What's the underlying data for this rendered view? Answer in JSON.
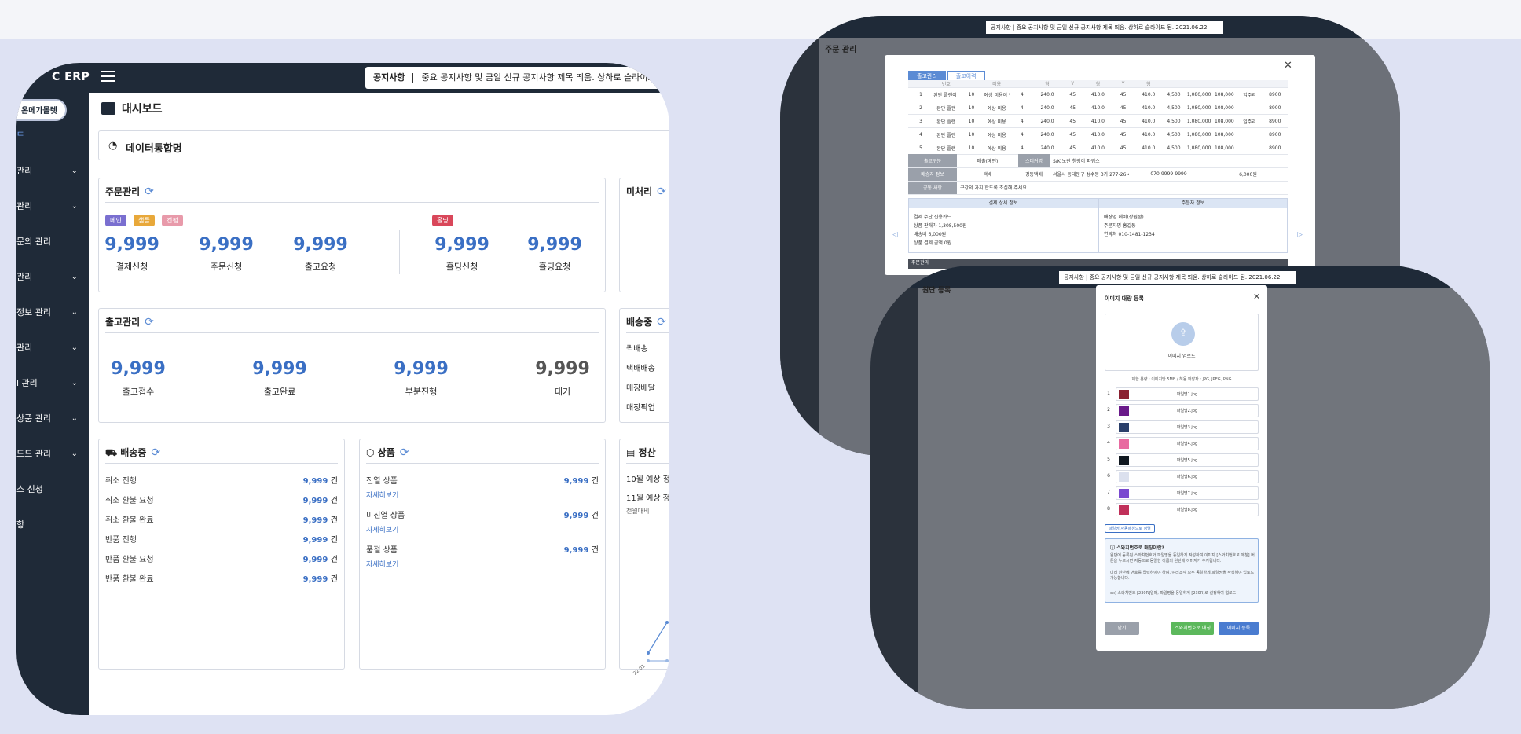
{
  "dashboard": {
    "logo": "C ERP",
    "notice_label": "공지사항",
    "notice_text": "중요 공지사항 및 금일 신규 공지사항 제목 띄움. 상하로 슬라이드",
    "sidebar_button": "온메가몰렛",
    "sidebar": [
      {
        "label": "드",
        "chev": ""
      },
      {
        "label": "관리",
        "chev": "⌄"
      },
      {
        "label": "관리",
        "chev": "⌄"
      },
      {
        "label": "문의 관리",
        "chev": ""
      },
      {
        "label": "관리",
        "chev": "⌄"
      },
      {
        "label": "정보 관리",
        "chev": "⌄"
      },
      {
        "label": "관리",
        "chev": "⌄"
      },
      {
        "label": "l 관리",
        "chev": "⌄"
      },
      {
        "label": "상품 관리",
        "chev": "⌄"
      },
      {
        "label": "드드 관리",
        "chev": "⌄"
      },
      {
        "label": "스 신청",
        "chev": ""
      },
      {
        "label": "항",
        "chev": ""
      }
    ],
    "page_title": "대시보드",
    "data_title": "데이터통합명",
    "order": {
      "title": "주문관리",
      "badges": [
        "메인",
        "샘플",
        "컨펌",
        "홀딩"
      ],
      "stats": [
        {
          "value": "9,999",
          "label": "결제신청"
        },
        {
          "value": "9,999",
          "label": "주문신청"
        },
        {
          "value": "9,999",
          "label": "출고요청"
        },
        {
          "value": "9,999",
          "label": "홀딩신청"
        },
        {
          "value": "9,999",
          "label": "홀딩요청"
        }
      ]
    },
    "pending": {
      "title": "미처리"
    },
    "release": {
      "title": "출고관리",
      "stats": [
        {
          "value": "9,999",
          "label": "출고접수"
        },
        {
          "value": "9,999",
          "label": "출고완료"
        },
        {
          "value": "9,999",
          "label": "부분진행"
        },
        {
          "value": "9,999",
          "label": "대기"
        }
      ]
    },
    "shipping_side": {
      "title": "배송중",
      "items": [
        "퀵배송",
        "택배배송",
        "매장배달",
        "매장픽업"
      ]
    },
    "shipping": {
      "title": "배송중",
      "unit": "건",
      "rows": [
        {
          "label": "취소 진행",
          "value": "9,999"
        },
        {
          "label": "취소 환불 요청",
          "value": "9,999"
        },
        {
          "label": "취소 환불 완료",
          "value": "9,999"
        },
        {
          "label": "반품 진행",
          "value": "9,999"
        },
        {
          "label": "반품 환불 요청",
          "value": "9,999"
        },
        {
          "label": "반품 환불 완료",
          "value": "9,999"
        }
      ]
    },
    "product": {
      "title": "상품",
      "unit": "건",
      "more": "자세히보기",
      "rows": [
        {
          "label": "진열 상품",
          "value": "9,999"
        },
        {
          "label": "미진열 상품",
          "value": "9,999"
        },
        {
          "label": "품절 상품",
          "value": "9,999"
        }
      ]
    },
    "settle": {
      "title": "정산",
      "rows": [
        "10월 예상 정",
        "11월 예상 정",
        "전월대비"
      ],
      "axis_label": "22.01"
    }
  },
  "order_modal": {
    "ticker": "공지사항  |  중요 공지사항 및 금일 신규 공지사항 제목 띄움. 상하로 슬라이드 됨.        2021.06.22",
    "page_title": "주문 관리",
    "tabs": [
      "출고관리",
      "출고이력"
    ],
    "header": [
      "",
      "번호",
      "",
      "미용",
      "",
      "형",
      "Y",
      "형",
      "Y",
      "형",
      "",
      "",
      "",
      "",
      "",
      "",
      "",
      "",
      "",
      ""
    ],
    "rows": [
      [
        "1",
        "완단 플랜이 잘려지면 ...",
        "10",
        "예상 미용이 잘린...",
        "4",
        "240.0",
        "45",
        "410.0",
        "45",
        "410.0",
        "4,500",
        "1,080,000",
        "108,000",
        "입주리",
        "8900"
      ],
      [
        "2",
        "완단 플랜",
        "10",
        "예상 미용",
        "4",
        "240.0",
        "45",
        "410.0",
        "45",
        "410.0",
        "4,500",
        "1,080,000",
        "108,000",
        "",
        "8900"
      ],
      [
        "3",
        "완단 플랜",
        "10",
        "예상 미용",
        "4",
        "240.0",
        "45",
        "410.0",
        "45",
        "410.0",
        "4,500",
        "1,080,000",
        "108,000",
        "입주리",
        "8900"
      ],
      [
        "4",
        "완단 플랜",
        "10",
        "예상 미용",
        "4",
        "240.0",
        "45",
        "410.0",
        "45",
        "410.0",
        "4,500",
        "1,080,000",
        "108,000",
        "",
        "8900"
      ],
      [
        "5",
        "완단 플랜",
        "10",
        "예상 미용",
        "4",
        "240.0",
        "45",
        "410.0",
        "45",
        "410.0",
        "4,500",
        "1,080,000",
        "108,000",
        "",
        "8900"
      ]
    ],
    "release_type_label": "출고구분",
    "release_type": "매출(메인)",
    "sticker_label": "스티커명",
    "sticker": "S/K 노란 행랭이 파워스",
    "delivery_label": "배송지 정보",
    "delivery_method": "택배",
    "receiver": "경동택배",
    "address": "서울시 동대문구 성수동 3가 277-26 4층",
    "phone": "070-9999-9999",
    "fee": "6,000원",
    "memo_label": "공동 사항",
    "memo": "구강의 가지 합도록 조심해 주세요.",
    "payment_caption": "결제 상세 정보",
    "orderer_caption": "주문자 정보",
    "payment": [
      "결제 수단   신용카드",
      "상품 판매가   1,308,500원",
      "배송비   6,000원",
      "상품 결제 금액   0원"
    ],
    "orderer": [
      "매장명   메비(장원점)",
      "주문자명   홍길동",
      "연락처   010-1481-1234"
    ],
    "footer": "주문관리"
  },
  "upload_modal": {
    "ticker": "공지사항  |  중요 공지사항 및 금일 신규 공지사항 제목 띄움. 상하로 슬라이드 됨.      2021.06.22",
    "page_title": "원단 등록",
    "title": "이미지 대량 등록",
    "upload": "이미지 업로드",
    "hint": "제한 용량 : 이미지당 5MB / 허용 확장자 : JPG, JPEG, PNG",
    "files": [
      {
        "n": "1",
        "name": "파일명1.jpg",
        "color": "#8a2030"
      },
      {
        "n": "2",
        "name": "파일명2.jpg",
        "color": "#6a1a8a"
      },
      {
        "n": "3",
        "name": "파일명3.jpg",
        "color": "#2a3f6a"
      },
      {
        "n": "4",
        "name": "파일명4.jpg",
        "color": "#e86aa0"
      },
      {
        "n": "5",
        "name": "파일명5.jpg",
        "color": "#101820"
      },
      {
        "n": "6",
        "name": "파일명6.jpg",
        "color": "#dbe0ee"
      },
      {
        "n": "7",
        "name": "파일명7.jpg",
        "color": "#7a4ad0"
      },
      {
        "n": "8",
        "name": "파일명8.jpg",
        "color": "#c0305a"
      }
    ],
    "auto_match": "파일명 자동매칭으로 정렬",
    "info_title": "스와치번호로 매칭이란?",
    "info_1": "원단에 등록된 스와치번호와 파일명을 동일하게 작성하여 이미지 [스와치번호로 매칭] 버튼을 누르시면 자동으로 동일한 이름의 원단에 이미지가 추가됩니다.",
    "info_2": "미리 원단에 번호를 입력하여야 하며, 여러조각 모두 동일하게 파일명을 작성해야 업로드 가능합니다.",
    "info_3": "ex) 스와치번호 [230R]일때, 파일명을 동일하게 [230R]로 설정하여 업로드",
    "btn_close": "닫기",
    "btn_match": "스와치번호로 매칭",
    "btn_register": "이미지 등록"
  }
}
